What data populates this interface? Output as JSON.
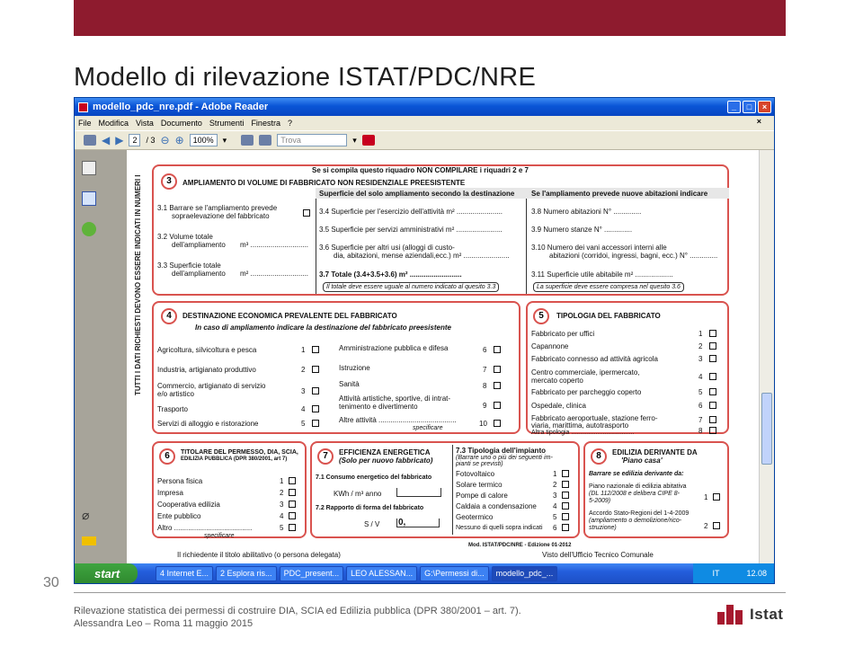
{
  "slide": {
    "title": "Modello di rilevazione ISTAT/PDC/NRE",
    "page_number": "30",
    "footer_line1": "Rilevazione statistica dei permessi di costruire DIA, SCIA ed Edilizia pubblica  (DPR 380/2001 – art. 7).",
    "footer_line2": "Alessandra Leo – Roma 11 maggio 2015",
    "logo_text": "Istat",
    "accent": "#8e1b2e"
  },
  "window": {
    "title": "modello_pdc_nre.pdf - Adobe Reader",
    "menu": [
      "File",
      "Modifica",
      "Vista",
      "Documento",
      "Strumenti",
      "Finestra",
      "?"
    ],
    "page_current": "2",
    "page_total": "/ 3",
    "zoom": "100%",
    "search_placeholder": "Trova"
  },
  "doc": {
    "vertical_note": "TUTTI I DATI RICHIESTI DEVONO ESSERE INDICATI IN NUMERI I",
    "header_note": "Se si compila questo riquadro NON COMPILARE i riquadri 2 e 7",
    "s3": {
      "num": "3",
      "title": "AMPLIAMENTO DI VOLUME DI FABBRICATO NON RESIDENZIALE PREESISTENTE",
      "col2_head": "Superficie del solo ampliamento secondo la destinazione",
      "col3_head": "Se l'ampliamento prevede nuove abitazioni indicare",
      "r31": "3.1  Barrare se l'ampliamento prevede",
      "r31b": "sopraelevazione del fabbricato",
      "r32": "3.2  Volume totale",
      "r32b": "dell'ampliamento",
      "r32u": "m³ .............................",
      "r33": "3.3  Superficie totale",
      "r33b": "dell'ampliamento",
      "r33u": "m² .............................",
      "r34": "3.4  Superficie per l'esercizio dell'attività   m² .......................",
      "r35": "3.5  Superficie per servizi amministrativi   m² .......................",
      "r36": "3.6  Superficie per altri usi (alloggi di custo-",
      "r36b": "dia, abitazioni, mense aziendali,ecc.)  m² .......................",
      "r37": "3.7  Totale  (3.4+3.5+3.6)          m² ..........................",
      "r37n": "Il totale deve essere uguale al numero indicato al quesito  3.3",
      "r38": "3.8   Numero abitazioni                    N° ..............",
      "r39": "3.9   Numero stanze                        N° ..............",
      "r310": "3.10  Numero dei vani accessori interni alle",
      "r310b": "abitazioni (corridoi, ingressi, bagni, ecc.)   N° ..............",
      "r311": "3.11  Superficie utile abitabile          m² ...................",
      "r311n": "La superficie deve essere compresa nel quesito 3.6"
    },
    "s4": {
      "num": "4",
      "title": "DESTINAZIONE ECONOMICA PREVALENTE  DEL FABBRICATO",
      "sub": "In caso di ampliamento indicare la destinazione del fabbricato preesistente",
      "left": [
        "Agricoltura, silvicoltura e pesca",
        "Industria, artigianato produttivo",
        "Commercio, artigianato di servizio",
        "Trasporto",
        "Servizi di alloggio e ristorazione"
      ],
      "left_extra": "e/o artistico",
      "left_n": [
        "1",
        "2",
        "3",
        "4",
        "5"
      ],
      "right": [
        "Amministrazione pubblica e difesa",
        "Istruzione",
        "Sanità",
        "Attività artistiche, sportive, di intrat-",
        "Altre attività ......................................."
      ],
      "right_extra": "tenimento e divertimento",
      "right_n": [
        "6",
        "7",
        "8",
        "9",
        "10"
      ],
      "specify": "specificare"
    },
    "s5": {
      "num": "5",
      "title": "TIPOLOGIA DEL FABBRICATO",
      "items": [
        "Fabbricato per uffici",
        "Capannone",
        "Fabbricato connesso ad attività agricola",
        "Centro commerciale, ipermercato,",
        "Fabbricato per parcheggio coperto",
        "Ospedale, clinica",
        "Fabbricato aeroportuale, stazione ferro-",
        "Altra tipologia ...................................."
      ],
      "extra4": "mercato coperto",
      "extra7": "viaria, marittima, autotrasporto",
      "n": [
        "1",
        "2",
        "3",
        "4",
        "5",
        "6",
        "7",
        "8"
      ],
      "specify": "specificare"
    },
    "s6": {
      "num": "6",
      "title": "TITOLARE DEL PERMESSO, DIA, SCIA,",
      "title2": "EDILIZIA PUBBLICA (DPR 380/2001, art 7)",
      "items": [
        "Persona fisica",
        "Impresa",
        "Cooperativa edilizia",
        "Ente pubblico",
        "Altro ......................................."
      ],
      "n": [
        "1",
        "2",
        "3",
        "4",
        "5"
      ],
      "specify": "specificare"
    },
    "s7": {
      "num": "7",
      "title": "EFFICIENZA ENERGETICA",
      "sub": "(Solo per nuovo fabbricato)",
      "r71": "7.1 Consumo energetico del fabbricato",
      "r71u": "KWh / m³ anno",
      "r72": "7.2 Rapporto di forma del fabbricato",
      "r72u": "S / V",
      "r72v": "0,",
      "r73": "7.3 Tipologia dell'impianto",
      "r73s": "(Barrare uno o più dei seguenti im-",
      "r73s2": "pianti se previsti)",
      "items": [
        "Fotovoltaico",
        "Solare termico",
        "Pompe di calore",
        "Caldaia a condensazione",
        "Geotermico",
        "Nessuno di quelli sopra indicati"
      ],
      "n": [
        "1",
        "2",
        "3",
        "4",
        "5",
        "6"
      ]
    },
    "s8": {
      "num": "8",
      "title": "EDILIZIA DERIVANTE DA",
      "title2": "'Piano casa'",
      "sub": "Barrare se edilizia derivante da:",
      "i1": "Piano nazionale di edilizia abitativa",
      "i1b": "(DL 112/2008 e delibera CIPE 8-",
      "i1c": "5-2009)",
      "i2": "Accordo Stato-Regioni del 1-4-2009",
      "i2b": "(ampliamento o demolizione/rico-",
      "i2c": "struzione)",
      "n": [
        "1",
        "2"
      ]
    },
    "model_id": "Mod. ISTAT/PDC/NRE - Edizione 01-2012",
    "bottom_left": "Il richiedente il titolo abilitativo (o persona delegata)",
    "bottom_right": "Visto dell'Ufficio Tecnico Comunale"
  },
  "taskbar": {
    "start": "start",
    "items": [
      "4 Internet E...",
      "2 Esplora ris...",
      "PDC_present...",
      "LEO ALESSAN...",
      "G:\\Permessi di...",
      "modello_pdc_..."
    ],
    "lang": "IT",
    "clock": "12.08"
  }
}
